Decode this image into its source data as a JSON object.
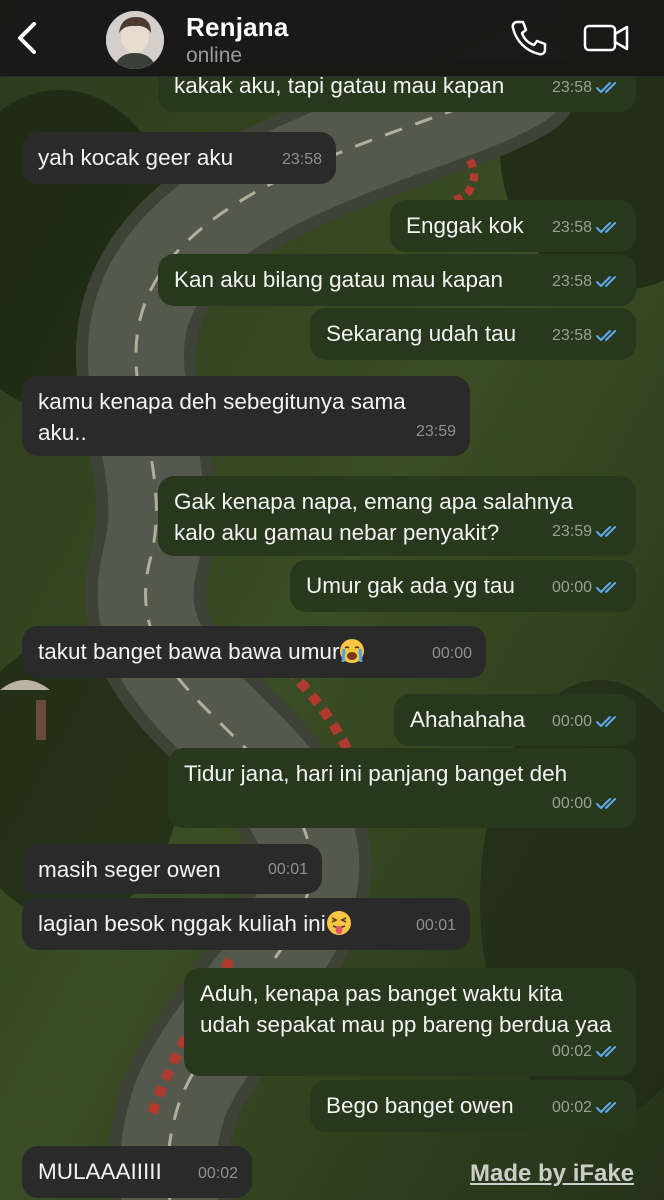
{
  "header": {
    "name": "Renjana",
    "status": "online"
  },
  "messages": [
    {
      "dir": "out",
      "text": "kakak aku, tapi gatau mau kapan",
      "time": "23:58"
    },
    {
      "dir": "in",
      "text": "yah kocak geer aku",
      "time": "23:58"
    },
    {
      "dir": "out",
      "text": "Enggak kok",
      "time": "23:58"
    },
    {
      "dir": "out",
      "text": "Kan aku bilang gatau mau kapan",
      "time": "23:58"
    },
    {
      "dir": "out",
      "text": "Sekarang udah tau",
      "time": "23:58"
    },
    {
      "dir": "in",
      "text": "kamu kenapa deh sebegitunya sama aku..",
      "time": "23:59"
    },
    {
      "dir": "out",
      "text": "Gak kenapa napa, emang apa salahnya kalo aku gamau nebar penyakit?",
      "time": "23:59"
    },
    {
      "dir": "out",
      "text": "Umur gak ada yg tau",
      "time": "00:00"
    },
    {
      "dir": "in",
      "text": "takut banget bawa bawa umur",
      "emoji": "loudly-crying-face",
      "time": "00:00"
    },
    {
      "dir": "out",
      "text": "Ahahahaha",
      "time": "00:00"
    },
    {
      "dir": "out",
      "text": "Tidur jana, hari ini panjang banget deh",
      "time": "00:00"
    },
    {
      "dir": "in",
      "text": "masih seger owen",
      "time": "00:01"
    },
    {
      "dir": "in",
      "text": "lagian besok nggak kuliah ini",
      "emoji": "squinting-tongue-face",
      "time": "00:01"
    },
    {
      "dir": "out",
      "text": "Aduh, kenapa pas banget waktu kita udah sepakat mau pp bareng berdua yaa",
      "time": "00:02"
    },
    {
      "dir": "out",
      "text": "Bego banget owen",
      "time": "00:02"
    },
    {
      "dir": "in",
      "text": "MULAAAIIIII",
      "time": "00:02"
    }
  ],
  "watermark": "Made by iFake",
  "colors": {
    "incoming_bubble": "#2a2a2a",
    "outgoing_bubble": "#27381c",
    "read_ticks": "#5fa8f5"
  },
  "icons": [
    "back-chevron-icon",
    "phone-icon",
    "video-camera-icon",
    "read-receipt-icon"
  ]
}
